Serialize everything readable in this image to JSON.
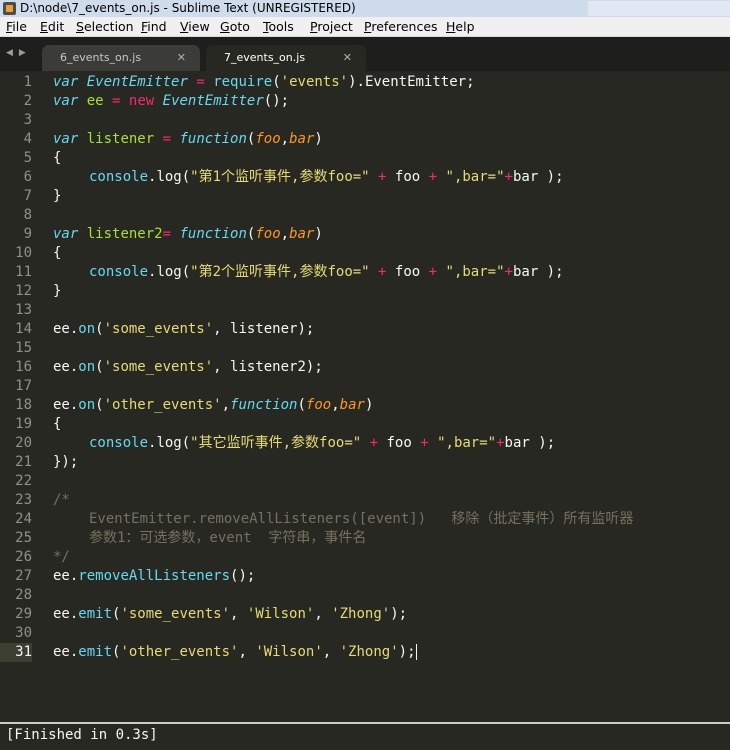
{
  "window": {
    "title": "D:\\node\\7_events_on.js - Sublime Text (UNREGISTERED)"
  },
  "menu": [
    "File",
    "Edit",
    "Selection",
    "Find",
    "View",
    "Goto",
    "Tools",
    "Project",
    "Preferences",
    "Help"
  ],
  "tabs": [
    {
      "label": "6_events_on.js",
      "active": false
    },
    {
      "label": "7_events_on.js",
      "active": true
    }
  ],
  "editor": {
    "current_line": 31,
    "line_numbers": [
      "1",
      "2",
      "3",
      "4",
      "5",
      "6",
      "7",
      "8",
      "9",
      "10",
      "11",
      "12",
      "13",
      "14",
      "15",
      "16",
      "17",
      "18",
      "19",
      "20",
      "21",
      "22",
      "23",
      "24",
      "25",
      "26",
      "27",
      "28",
      "29",
      "30",
      "31"
    ],
    "lines": [
      "var EventEmitter = require('events').EventEmitter;",
      "var ee = new EventEmitter();",
      "",
      "var listener = function(foo,bar)",
      "{",
      "    console.log(\"第1个监听事件,参数foo=\" + foo + \",bar=\"+bar );",
      "}",
      "",
      "var listener2= function(foo,bar)",
      "{",
      "    console.log(\"第2个监听事件,参数foo=\" + foo + \",bar=\"+bar );",
      "}",
      "",
      "ee.on('some_events', listener);",
      "",
      "ee.on('some_events', listener2);",
      "",
      "ee.on('other_events',function(foo,bar)",
      "{",
      "    console.log(\"其它监听事件,参数foo=\" + foo + \",bar=\"+bar );",
      "});",
      "",
      "/*",
      "    EventEmitter.removeAllListeners([event])   移除（批定事件）所有监听器",
      "    参数1：可选参数，event  字符串，事件名",
      "*/",
      "ee.removeAllListeners();",
      "",
      "ee.emit('some_events', 'Wilson', 'Zhong');",
      "",
      "ee.emit('other_events', 'Wilson', 'Zhong');"
    ]
  },
  "output_panel": {
    "text": "[Finished in 0.3s]"
  },
  "colors": {
    "background": "#272822",
    "keyword": "#66d9ef",
    "function_name": "#a6e22e",
    "operator": "#f92672",
    "string": "#e6db74",
    "parameter": "#fd971f",
    "comment": "#75715e",
    "text": "#f8f8f2"
  }
}
